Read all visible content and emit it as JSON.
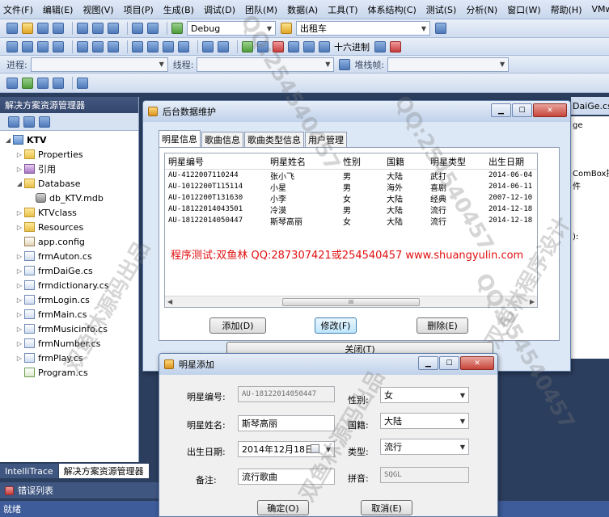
{
  "menubar": {
    "items": [
      "文件(F)",
      "编辑(E)",
      "视图(V)",
      "项目(P)",
      "生成(B)",
      "调试(D)",
      "团队(M)",
      "数据(A)",
      "工具(T)",
      "体系结构(C)",
      "测试(S)",
      "分析(N)",
      "窗口(W)",
      "帮助(H)",
      "VMware"
    ]
  },
  "toolbar": {
    "config": "Debug",
    "platform": "出租车",
    "process_label": "进程:",
    "thread_label": "线程:",
    "stack_label": "堆栈帧:",
    "hex_label": "十六进制"
  },
  "solution_explorer": {
    "title": "解决方案资源管理器",
    "items": [
      {
        "label": "KTV",
        "kind": "project",
        "indent": 0,
        "expander": "◢"
      },
      {
        "label": "Properties",
        "kind": "folder",
        "indent": 1,
        "expander": "▷"
      },
      {
        "label": "引用",
        "kind": "ref",
        "indent": 1,
        "expander": "▷"
      },
      {
        "label": "Database",
        "kind": "folder",
        "indent": 1,
        "expander": "◢"
      },
      {
        "label": "db_KTV.mdb",
        "kind": "db",
        "indent": 2,
        "expander": ""
      },
      {
        "label": "KTVclass",
        "kind": "folder",
        "indent": 1,
        "expander": "▷"
      },
      {
        "label": "Resources",
        "kind": "folder",
        "indent": 1,
        "expander": "▷"
      },
      {
        "label": "app.config",
        "kind": "config",
        "indent": 1,
        "expander": ""
      },
      {
        "label": "frmAuton.cs",
        "kind": "form",
        "indent": 1,
        "expander": "▷"
      },
      {
        "label": "frmDaiGe.cs",
        "kind": "form",
        "indent": 1,
        "expander": "▷"
      },
      {
        "label": "frmdictionary.cs",
        "kind": "form",
        "indent": 1,
        "expander": "▷"
      },
      {
        "label": "frmLogin.cs",
        "kind": "form",
        "indent": 1,
        "expander": "▷"
      },
      {
        "label": "frmMain.cs",
        "kind": "form",
        "indent": 1,
        "expander": "▷"
      },
      {
        "label": "frmMusicinfo.cs",
        "kind": "form",
        "indent": 1,
        "expander": "▷"
      },
      {
        "label": "frmNumber.cs",
        "kind": "form",
        "indent": 1,
        "expander": "▷"
      },
      {
        "label": "frmPlay.cs",
        "kind": "form",
        "indent": 1,
        "expander": "▷"
      },
      {
        "label": "Program.cs",
        "kind": "code",
        "indent": 1,
        "expander": ""
      }
    ]
  },
  "bottom_tabs": [
    "IntelliTrace",
    "解决方案资源管理器"
  ],
  "error_list": "错误列表",
  "status": "就绪",
  "editor": {
    "tab": "DaiGe.cs",
    "tab2": "ge",
    "line1": "ComBox控",
    "line2": "件",
    "line3": "):"
  },
  "backend_window": {
    "title": "后台数据维护",
    "tabs": [
      "明星信息",
      "歌曲信息",
      "歌曲类型信息",
      "用户管理"
    ],
    "columns": [
      "明星编号",
      "明星姓名",
      "性别",
      "国籍",
      "明星类型",
      "出生日期"
    ],
    "rows": [
      [
        "AU-4122007110244",
        "张小飞",
        "男",
        "大陆",
        "武打",
        "2014-06-04"
      ],
      [
        "AU-1012200T115114",
        "小星",
        "男",
        "海外",
        "喜剧",
        "2014-06-11"
      ],
      [
        "AU-1012200T131630",
        "小李",
        "女",
        "大陆",
        "经典",
        "2007-12-10"
      ],
      [
        "AU-18122014043501",
        "冷漠",
        "男",
        "大陆",
        "流行",
        "2014-12-18"
      ],
      [
        "AU-18122014050447",
        "斯琴高丽",
        "女",
        "大陆",
        "流行",
        "2014-12-18"
      ]
    ],
    "scroll_thumb": "III",
    "promo": "程序测试:双鱼林 QQ:287307421或254540457 www.shuangyulin.com",
    "buttons": {
      "add": "添加(D)",
      "edit": "修改(F)",
      "delete": "删除(E)",
      "close": "关闭(T)"
    }
  },
  "add_window": {
    "title": "明星添加",
    "labels": {
      "id": "明星编号:",
      "name": "明星姓名:",
      "birth": "出生日期:",
      "note": "备注:",
      "gender": "性别:",
      "country": "国籍:",
      "type": "类型:",
      "pinyin": "拼音:"
    },
    "values": {
      "id": "AU-18122014050447",
      "name": "斯琴高丽",
      "birth": "2014年12月18日",
      "note": "流行歌曲",
      "gender": "女",
      "country": "大陆",
      "type": "流行",
      "pinyin": "SQGL"
    },
    "buttons": {
      "ok": "确定(O)",
      "cancel": "取消(E)"
    }
  },
  "watermarks": [
    "双鱼林源码出品",
    "QQ:254540457",
    "双鱼林程序设计",
    "QQ:254540457",
    "双鱼林源码出品",
    "QQ:254540457"
  ]
}
